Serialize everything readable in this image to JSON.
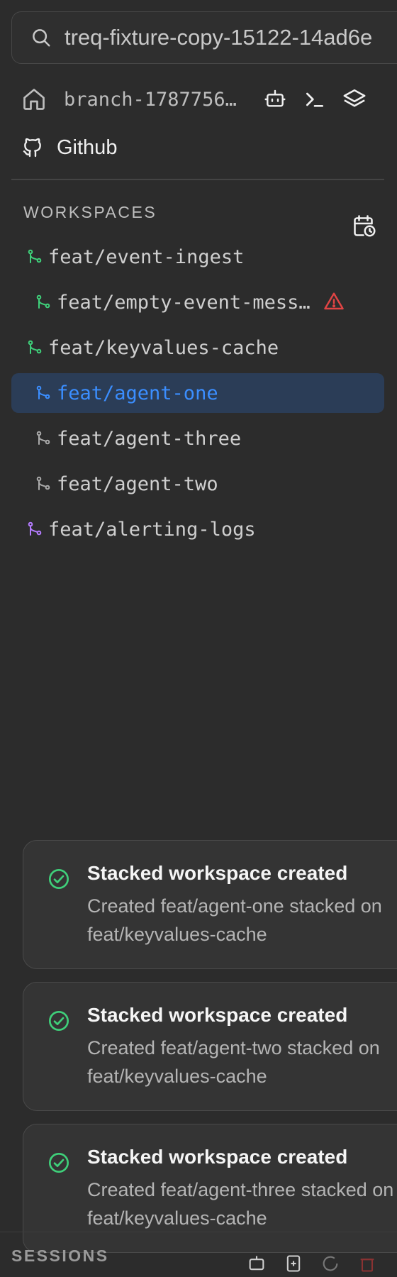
{
  "search": {
    "value": "treq-fixture-copy-15122-14ad6e"
  },
  "branch": {
    "name": "branch-1787756…"
  },
  "github": {
    "label": "Github"
  },
  "workspaces": {
    "header": "WORKSPACES",
    "items": [
      {
        "label": "feat/event-ingest",
        "icon_color": "#3fd07a",
        "selected": false,
        "warning": false
      },
      {
        "label": "feat/empty-event-mess…",
        "icon_color": "#3fd07a",
        "selected": false,
        "warning": true
      },
      {
        "label": "feat/keyvalues-cache",
        "icon_color": "#3fd07a",
        "selected": false,
        "warning": false
      },
      {
        "label": "feat/agent-one",
        "icon_color": "#3b8eff",
        "selected": true,
        "warning": false
      },
      {
        "label": "feat/agent-three",
        "icon_color": "#a9a9a9",
        "selected": false,
        "warning": false
      },
      {
        "label": "feat/agent-two",
        "icon_color": "#a9a9a9",
        "selected": false,
        "warning": false
      },
      {
        "label": "feat/alerting-logs",
        "icon_color": "#b57cff",
        "selected": false,
        "warning": false
      }
    ]
  },
  "toasts": [
    {
      "title": "Stacked workspace created",
      "line1": "Created feat/agent-one stacked on",
      "line2": "feat/keyvalues-cache"
    },
    {
      "title": "Stacked workspace created",
      "line1": "Created feat/agent-two stacked on",
      "line2": "feat/keyvalues-cache"
    },
    {
      "title": "Stacked workspace created",
      "line1": "Created feat/agent-three stacked on",
      "line2": "feat/keyvalues-cache"
    }
  ],
  "sessions": {
    "label": "SESSIONS"
  },
  "colors": {
    "accent": "#3b8eff",
    "success": "#3fd07a",
    "warning": "#e04444",
    "selected_bg": "#2b3d57"
  },
  "icons": [
    "search-icon",
    "home-icon",
    "robot-icon",
    "terminal-icon",
    "layers-icon",
    "github-icon",
    "calendar-clock-icon",
    "git-branch-icon",
    "warning-icon",
    "check-circle-icon"
  ]
}
